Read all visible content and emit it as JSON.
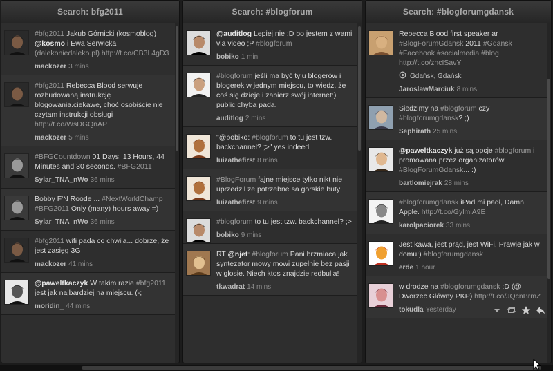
{
  "columns": [
    {
      "title": "Search: bfg2011",
      "tweets": [
        {
          "parts": [
            [
              "tag",
              "#bfg2011"
            ],
            [
              "t",
              " Jakub Górnicki (kosmoblog) "
            ],
            [
              "mention",
              "@kosmo"
            ],
            [
              "t",
              " i Ewa Serwicka "
            ],
            [
              "link",
              "(dalekoniedaleko.pl)"
            ],
            [
              "t",
              " "
            ],
            [
              "link",
              "http://t.co/CB3L4gD3"
            ]
          ],
          "user": "mackozer",
          "time": "3 mins",
          "avatar": "dark"
        },
        {
          "parts": [
            [
              "tag",
              "#bfg2011"
            ],
            [
              "t",
              " Rebecca Blood serwuje rozbudowaną instrukcję blogowania.ciekawe, choć osobiście nie czytam instrukcji obsługi "
            ],
            [
              "link",
              "http://t.co/WsDGQnAP"
            ]
          ],
          "user": "mackozer",
          "time": "5 mins",
          "avatar": "dark"
        },
        {
          "parts": [
            [
              "tag",
              "#BFGCountdown"
            ],
            [
              "t",
              " 01 Days, 13 Hours, 44 Minutes and 30 seconds. "
            ],
            [
              "tag",
              "#BFG2011"
            ]
          ],
          "user": "Sylar_TNA_nWo",
          "time": "36 mins",
          "avatar": "group"
        },
        {
          "parts": [
            [
              "t",
              "Bobby F'N Roode ... "
            ],
            [
              "tag",
              "#NextWorldChamp"
            ],
            [
              "t",
              " "
            ],
            [
              "tag",
              "#BFG2011"
            ],
            [
              "t",
              " Only (many) hours away =)"
            ]
          ],
          "user": "Sylar_TNA_nWo",
          "time": "36 mins",
          "avatar": "group"
        },
        {
          "parts": [
            [
              "tag",
              "#bfg2011"
            ],
            [
              "t",
              " wifi pada co chwila... dobrze, że jest zasięg 3G"
            ]
          ],
          "user": "mackozer",
          "time": "41 mins",
          "avatar": "dark"
        },
        {
          "parts": [
            [
              "mention",
              "@paweltkaczyk"
            ],
            [
              "t",
              " W takim razie "
            ],
            [
              "tag",
              "#bfg2011"
            ],
            [
              "t",
              " jest jak najbardziej na miejscu. (-;"
            ]
          ],
          "user": "moridin_",
          "time": "44 mins",
          "avatar": "bw"
        }
      ]
    },
    {
      "title": "Search: #blogforum",
      "tweets": [
        {
          "parts": [
            [
              "mention",
              "@auditlog"
            ],
            [
              "t",
              " Lepiej nie :D bo jestem z wami via video ;P "
            ],
            [
              "tag",
              "#blogforum"
            ]
          ],
          "user": "bobiko",
          "time": "1 min",
          "avatar": "shades"
        },
        {
          "parts": [
            [
              "tag",
              "#blogforum"
            ],
            [
              "t",
              " jeśli ma być tylu blogerów i blogerek w jednym miejscu, to wiedz, że coś się dzieje i zabierz swój internet:) public chyba pada."
            ]
          ],
          "user": "auditlog",
          "time": "2 mins",
          "avatar": "suit"
        },
        {
          "parts": [
            [
              "t",
              "\"@bobiko: "
            ],
            [
              "tag",
              "#blogforum"
            ],
            [
              "t",
              " to tu jest tzw. backchannel? ;>\" yes indeed"
            ]
          ],
          "user": "luizathefirst",
          "time": "8 mins",
          "avatar": "glasses"
        },
        {
          "parts": [
            [
              "tag",
              "#BlogForum"
            ],
            [
              "t",
              " fajne miejsce tylko nikt nie uprzedzil ze potrzebne sa gorskie buty"
            ]
          ],
          "user": "luizathefirst",
          "time": "9 mins",
          "avatar": "glasses"
        },
        {
          "parts": [
            [
              "tag",
              "#blogforum"
            ],
            [
              "t",
              " to tu jest tzw. backchannel? ;>"
            ]
          ],
          "user": "bobiko",
          "time": "9 mins",
          "avatar": "shades"
        },
        {
          "parts": [
            [
              "t",
              "RT "
            ],
            [
              "mention",
              "@njet"
            ],
            [
              "t",
              ": "
            ],
            [
              "tag",
              "#blogforum"
            ],
            [
              "t",
              " Pani brzmiaca jak syntezator mowy mowi zupelnie bez pasji w glosie. Niech ktos znajdzie redbulla!"
            ]
          ],
          "user": "tkwadrat",
          "time": "14 mins",
          "avatar": "warm"
        }
      ]
    },
    {
      "title": "Search: #blogforumgdansk",
      "tweets": [
        {
          "parts": [
            [
              "t",
              "Rebecca Blood first speaker ar "
            ],
            [
              "tag",
              "#BlogForumGdansk"
            ],
            [
              "t",
              " 2011 "
            ],
            [
              "tag",
              "#Gdansk"
            ],
            [
              "t",
              " "
            ],
            [
              "tag",
              "#Facebook"
            ],
            [
              "t",
              " "
            ],
            [
              "tag",
              "#socialmedia"
            ],
            [
              "t",
              " "
            ],
            [
              "tag",
              "#blog"
            ],
            [
              "t",
              " "
            ],
            [
              "link",
              "http://t.co/zncISavY"
            ]
          ],
          "geo": "Gdańsk, Gdańsk",
          "user": "JaroslawMarciuk",
          "time": "8 mins",
          "avatar": "tan"
        },
        {
          "parts": [
            [
              "t",
              "Siedzimy na "
            ],
            [
              "tag",
              "#blogforum"
            ],
            [
              "t",
              " czy "
            ],
            [
              "tag",
              "#blogforumgdansk"
            ],
            [
              "t",
              "? ;)"
            ]
          ],
          "user": "Sephirath",
          "time": "25 mins",
          "avatar": "street"
        },
        {
          "parts": [
            [
              "mention",
              "@paweltkaczyk"
            ],
            [
              "t",
              " już są opcje "
            ],
            [
              "tag",
              "#blogforum"
            ],
            [
              "t",
              " i promowana przez organizatorów "
            ],
            [
              "tag",
              "#BlogForumGdansk"
            ],
            [
              "t",
              "... :)"
            ]
          ],
          "user": "bartlomiejrak",
          "time": "28 mins",
          "avatar": "smile"
        },
        {
          "parts": [
            [
              "tag",
              "#blogforumgdansk"
            ],
            [
              "t",
              " iPad mi padł, Damn Apple. "
            ],
            [
              "link",
              "http://t.co/GylmiA9E"
            ]
          ],
          "user": "karolpaciorek",
          "time": "33 mins",
          "avatar": "bw2"
        },
        {
          "parts": [
            [
              "t",
              "Jest kawa, jest prąd, jest WiFi. Prawie jak w domu:) "
            ],
            [
              "tag",
              "#blogforumgdansk"
            ]
          ],
          "user": "erde",
          "time": "1 hour",
          "avatar": "cartoon"
        },
        {
          "parts": [
            [
              "t",
              "w drodze na "
            ],
            [
              "tag",
              "#blogforumgdansk"
            ],
            [
              "t",
              " :D (@ Dworzec Główny PKP) "
            ],
            [
              "link",
              "http://t.co/JQcnBrmZ"
            ]
          ],
          "user": "tokudla",
          "time": "Yesterday",
          "avatar": "pink",
          "actions": true
        }
      ]
    }
  ],
  "icons": {
    "geo": "location-icon",
    "dropdown": "chevron-down-icon",
    "retweet": "retweet-icon",
    "favorite": "star-icon",
    "reply": "reply-icon"
  }
}
